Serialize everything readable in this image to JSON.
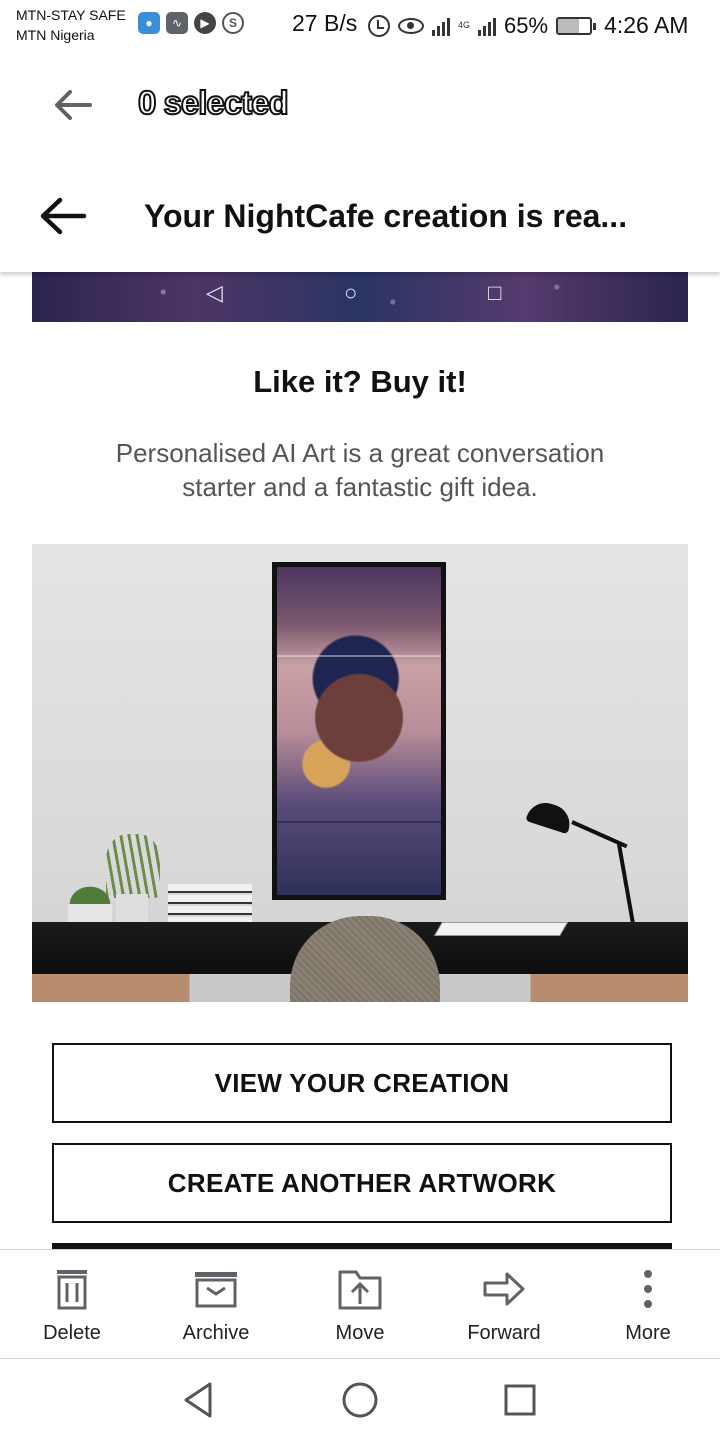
{
  "status_bar": {
    "carrier_line1": "MTN-STAY SAFE",
    "carrier_line2": "MTN Nigeria",
    "net_speed": "27 B/s",
    "network_type": "4G",
    "battery": "65%",
    "time": "4:26 AM",
    "icons": [
      "shield-icon",
      "activity-icon",
      "play-icon",
      "s-icon",
      "alarm-icon",
      "eye-icon",
      "signal-icon",
      "battery-icon"
    ]
  },
  "selection_bar": {
    "title": "0 selected"
  },
  "mail_header": {
    "subject": "Your NightCafe creation is rea..."
  },
  "content": {
    "promo_title": "Like it? Buy it!",
    "promo_text": "Personalised AI Art is a great conversation starter and a fantastic gift idea."
  },
  "buttons": {
    "view_creation": "VIEW YOUR CREATION",
    "create_another": "CREATE ANOTHER ARTWORK"
  },
  "actions": [
    {
      "label": "Delete",
      "icon": "trash-icon"
    },
    {
      "label": "Archive",
      "icon": "archive-icon"
    },
    {
      "label": "Move",
      "icon": "move-icon"
    },
    {
      "label": "Forward",
      "icon": "forward-icon"
    },
    {
      "label": "More",
      "icon": "more-vertical-icon"
    }
  ],
  "colors": {
    "text": "#111111",
    "secondary_text": "#555555",
    "accent_blue": "#3b8fd9"
  }
}
